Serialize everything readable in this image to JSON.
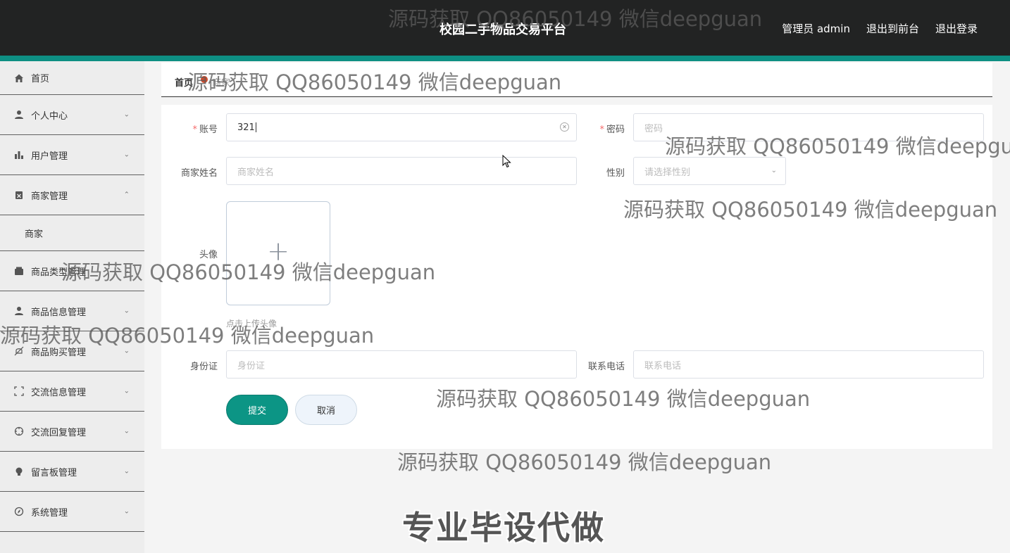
{
  "header": {
    "title": "校园二手物品交易平台",
    "links": [
      "管理员 admin",
      "退出到前台",
      "退出登录"
    ]
  },
  "sidebar": {
    "items": [
      {
        "label": "首页",
        "icon": "home-icon",
        "chevron": ""
      },
      {
        "label": "个人中心",
        "icon": "user-icon",
        "chevron": "down"
      },
      {
        "label": "用户管理",
        "icon": "bar-chart-icon",
        "chevron": "down"
      },
      {
        "label": "商家管理",
        "icon": "clipboard-icon",
        "chevron": "up"
      },
      {
        "label": "商品类型管理",
        "icon": "wallet-icon",
        "chevron": "down"
      },
      {
        "label": "商品信息管理",
        "icon": "user-icon",
        "chevron": "down"
      },
      {
        "label": "商品购买管理",
        "icon": "bell-off-icon",
        "chevron": "down"
      },
      {
        "label": "交流信息管理",
        "icon": "fullscreen-icon",
        "chevron": "down"
      },
      {
        "label": "交流回复管理",
        "icon": "crosshair-icon",
        "chevron": "down"
      },
      {
        "label": "留言板管理",
        "icon": "bulb-icon",
        "chevron": "down"
      },
      {
        "label": "系统管理",
        "icon": "compass-icon",
        "chevron": "down"
      }
    ],
    "subitem": "商家"
  },
  "breadcrumb": {
    "home": "首页",
    "current": "商家"
  },
  "form": {
    "account_label": "账号",
    "account_value": "321",
    "password_label": "密码",
    "password_placeholder": "密码",
    "name_label": "商家姓名",
    "name_placeholder": "商家姓名",
    "gender_label": "性别",
    "gender_placeholder": "请选择性别",
    "avatar_label": "头像",
    "avatar_tip": "点击上传头像",
    "idcard_label": "身份证",
    "idcard_placeholder": "身份证",
    "phone_label": "联系电话",
    "phone_placeholder": "联系电话",
    "submit": "提交",
    "cancel": "取消"
  },
  "watermarks": {
    "qq": "源码获取 QQ86050149 微信deepguan",
    "big": "专业毕设代做"
  },
  "colors": {
    "header_bg": "#222323",
    "accent": "#0e8f83",
    "required": "#f56c6c"
  }
}
